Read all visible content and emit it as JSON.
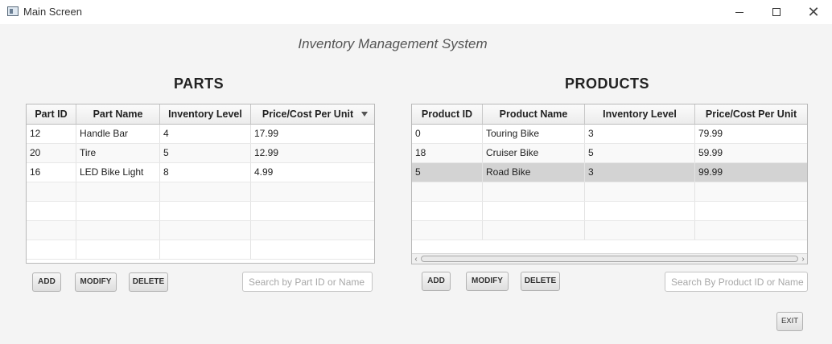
{
  "window": {
    "title": "Main Screen",
    "minimize": "",
    "maximize": "",
    "close": "✕"
  },
  "app_title": "Inventory Management System",
  "parts": {
    "title": "PARTS",
    "columns": [
      "Part ID",
      "Part Name",
      "Inventory Level",
      "Price/Cost Per Unit"
    ],
    "rows": [
      [
        "12",
        "Handle Bar",
        "4",
        "17.99"
      ],
      [
        "20",
        "Tire",
        "5",
        "12.99"
      ],
      [
        "16",
        "LED Bike Light",
        "8",
        "4.99"
      ]
    ],
    "buttons": {
      "add": "ADD",
      "modify": "MODIFY",
      "delete": "DELETE"
    },
    "search_placeholder": "Search by Part ID or Name"
  },
  "products": {
    "title": "PRODUCTS",
    "columns": [
      "Product ID",
      "Product Name",
      "Inventory Level",
      "Price/Cost Per Unit"
    ],
    "rows": [
      [
        "0",
        "Touring Bike",
        "3",
        "79.99"
      ],
      [
        "18",
        "Cruiser Bike",
        "5",
        "59.99"
      ],
      [
        "5",
        "Road Bike",
        "3",
        "99.99"
      ]
    ],
    "buttons": {
      "add": "ADD",
      "modify": "MODIFY",
      "delete": "DELETE"
    },
    "search_placeholder": "Search By Product ID or Name"
  },
  "exit_label": "EXIT",
  "icons": {
    "app": "window-app-icon",
    "sort": "sort-descending-icon",
    "scroll_left": "chevron-left-icon",
    "scroll_right": "chevron-right-icon"
  }
}
